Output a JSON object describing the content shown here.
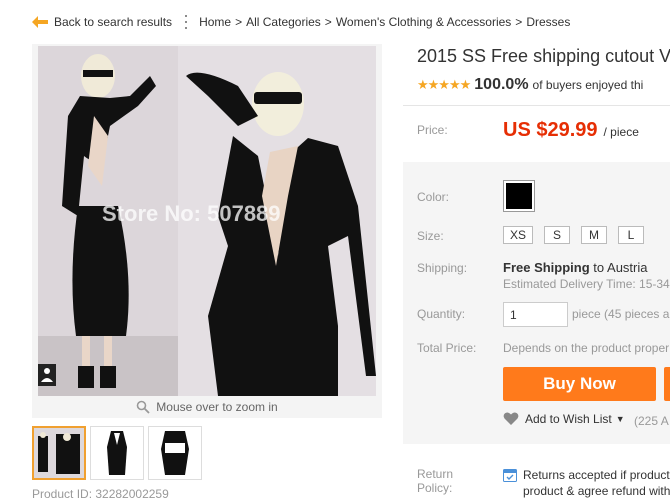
{
  "breadcrumb": {
    "back_label": "Back to search results",
    "items": [
      "Home",
      "All Categories",
      "Women's Clothing & Accessories",
      "Dresses"
    ],
    "separator": ">"
  },
  "gallery": {
    "watermark": "Store No: 507889",
    "zoom_hint": "Mouse over to zoom in",
    "thumbnail_count": 3,
    "product_id_label": "Product ID: 32282002259"
  },
  "product": {
    "title": "2015 SS Free shipping cutout V",
    "stars": "★★★★★",
    "rating_percent": "100.0%",
    "rating_text": "of buyers enjoyed thi"
  },
  "price": {
    "label": "Price:",
    "value": "US $29.99",
    "unit": "/ piece"
  },
  "options": {
    "color_label": "Color:",
    "selected_color": "#000000",
    "size_label": "Size:",
    "sizes": [
      "XS",
      "S",
      "M",
      "L"
    ],
    "shipping_label": "Shipping:",
    "shipping_method": "Free Shipping",
    "shipping_to": "to Austria",
    "delivery": "Estimated Delivery Time: 15-34",
    "quantity_label": "Quantity:",
    "quantity_value": "1",
    "quantity_note": "piece (45 pieces a",
    "total_label": "Total Price:",
    "total_note": "Depends on the product proper"
  },
  "actions": {
    "buy_now": "Buy Now",
    "wish_list": "Add to Wish List",
    "wish_count": "(225 A"
  },
  "return_policy": {
    "label_line1": "Return",
    "label_line2": "Policy:",
    "text_line1": "Returns accepted if product",
    "text_line2": "product & agree refund with"
  },
  "colors": {
    "accent_orange": "#ff7a1b",
    "price_red": "#e62e04",
    "star_gold": "#f5a623"
  }
}
